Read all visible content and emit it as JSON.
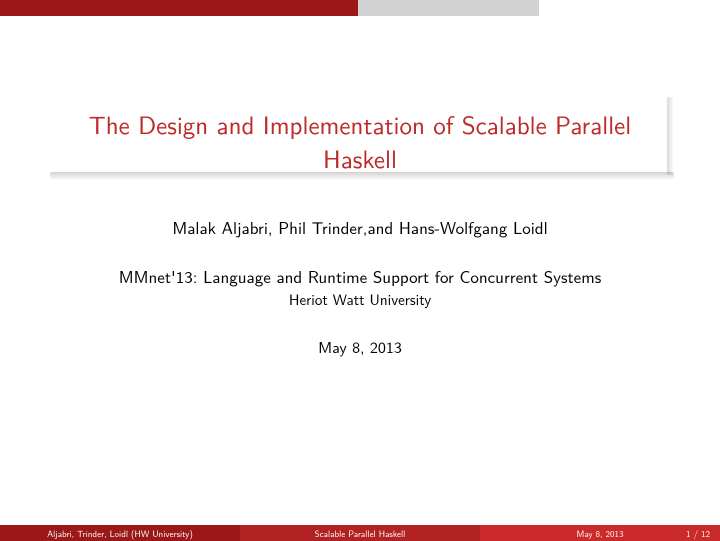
{
  "title": "The Design and Implementation of Scalable Parallel Haskell",
  "authors": "Malak Aljabri, Phil Trinder,and Hans-Wolfgang Loidl",
  "conference": "MMnet'13: Language and Runtime Support for Concurrent Systems",
  "university": "Heriot Watt University",
  "date": "May 8, 2013",
  "footer": {
    "authors_short": "Aljabri, Trinder, Loidl  (HW University)",
    "title_short": "Scalable Parallel Haskell",
    "date": "May 8, 2013",
    "page": "1 / 12"
  }
}
